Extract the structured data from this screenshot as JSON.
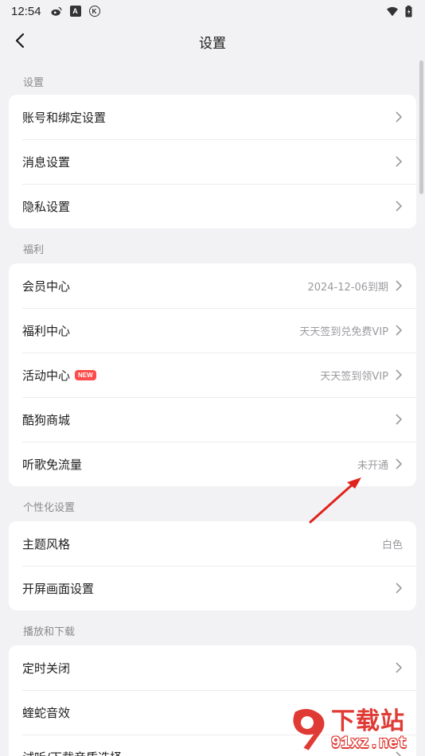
{
  "status_bar": {
    "time": "12:54"
  },
  "header": {
    "title": "设置"
  },
  "sections": [
    {
      "title": "设置",
      "rows": [
        {
          "label": "账号和绑定设置",
          "value": "",
          "chevron": true
        },
        {
          "label": "消息设置",
          "value": "",
          "chevron": true
        },
        {
          "label": "隐私设置",
          "value": "",
          "chevron": true
        }
      ]
    },
    {
      "title": "福利",
      "rows": [
        {
          "label": "会员中心",
          "value": "2024-12-06到期",
          "chevron": true
        },
        {
          "label": "福利中心",
          "value": "天天签到兑免费VIP",
          "chevron": true
        },
        {
          "label": "活动中心",
          "badge": "NEW",
          "value": "天天签到领VIP",
          "chevron": true
        },
        {
          "label": "酷狗商城",
          "value": "",
          "chevron": true
        },
        {
          "label": "听歌免流量",
          "value": "未开通",
          "chevron": true
        }
      ]
    },
    {
      "title": "个性化设置",
      "rows": [
        {
          "label": "主题风格",
          "value": "白色",
          "chevron": false
        },
        {
          "label": "开屏画面设置",
          "value": "",
          "chevron": true
        }
      ]
    },
    {
      "title": "播放和下载",
      "rows": [
        {
          "label": "定时关闭",
          "value": "",
          "chevron": true
        },
        {
          "label": "蝰蛇音效",
          "value": "",
          "chevron": false
        },
        {
          "label": "试听/下载音质选择",
          "value": "",
          "chevron": true
        }
      ]
    }
  ],
  "watermark": {
    "title": "下载站",
    "url": "91xz.net"
  },
  "colors": {
    "accent_red": "#e03a34",
    "badge_red": "#ff4a4a",
    "background": "#f2f2f4",
    "card": "#ffffff"
  }
}
